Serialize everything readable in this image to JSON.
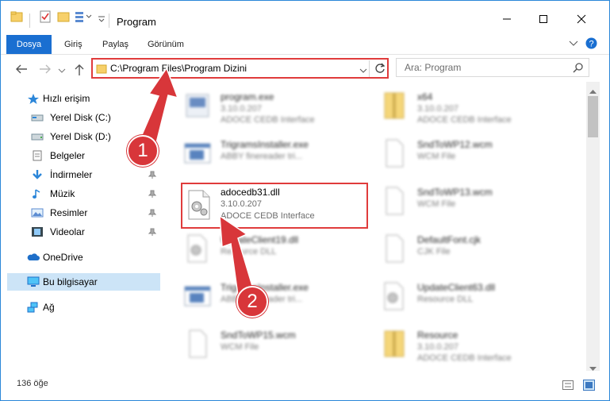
{
  "window": {
    "title": "Program"
  },
  "ribbon": {
    "tabs": [
      "Dosya",
      "Giriş",
      "Paylaş",
      "Görünüm"
    ]
  },
  "address": {
    "path": "C:\\Program Files\\Program Dizini"
  },
  "search": {
    "placeholder": "Ara: Program"
  },
  "nav": {
    "items": [
      {
        "label": "Hızlı erişim",
        "icon": "star-icon"
      },
      {
        "label": "Yerel Disk (C:)",
        "icon": "drive-icon"
      },
      {
        "label": "Yerel Disk (D:)",
        "icon": "drive-icon"
      },
      {
        "label": "Belgeler",
        "icon": "document-icon"
      },
      {
        "label": "İndirmeler",
        "icon": "download-icon"
      },
      {
        "label": "Müzik",
        "icon": "music-icon"
      },
      {
        "label": "Resimler",
        "icon": "pictures-icon"
      },
      {
        "label": "Videolar",
        "icon": "video-icon"
      },
      {
        "label": "OneDrive",
        "icon": "cloud-icon"
      },
      {
        "label": "Bu bilgisayar",
        "icon": "computer-icon"
      },
      {
        "label": "Ağ",
        "icon": "network-icon"
      }
    ]
  },
  "files": [
    {
      "name": "program.exe",
      "line2": "3.10.0.207",
      "line3": "ADOCE CEDB Interface",
      "icon": "exe-icon"
    },
    {
      "name": "x64",
      "line2": "3.10.0.207",
      "line3": "ADOCE CEDB Interface",
      "icon": "archive-icon"
    },
    {
      "name": "TrigramsInstaller.exe",
      "line2": "ABBY finereader tri...",
      "line3": "",
      "icon": "app-window-icon"
    },
    {
      "name": "SndToWP12.wcm",
      "line2": "WCM File",
      "line3": "",
      "icon": "file-icon"
    },
    {
      "name": "adocedb31.dll",
      "line2": "3.10.0.207",
      "line3": "ADOCE CEDB Interface",
      "icon": "dll-gear-icon"
    },
    {
      "name": "SndToWP13.wcm",
      "line2": "WCM File",
      "line3": "",
      "icon": "file-icon"
    },
    {
      "name": "UpdateClient19.dll",
      "line2": "Resource DLL",
      "line3": "",
      "icon": "dll-gear-icon"
    },
    {
      "name": "DefaultFont.cjk",
      "line2": "CJK File",
      "line3": "",
      "icon": "file-icon"
    },
    {
      "name": "TrigramsInstaller.exe",
      "line2": "ABBY finereader tri...",
      "line3": "",
      "icon": "app-window-icon"
    },
    {
      "name": "UpdateClient63.dll",
      "line2": "Resource DLL",
      "line3": "",
      "icon": "dll-gear-icon"
    },
    {
      "name": "SndToWP15.wcm",
      "line2": "WCM File",
      "line3": "",
      "icon": "file-icon"
    },
    {
      "name": "Resource",
      "line2": "3.10.0.207",
      "line3": "ADOCE CEDB Interface",
      "icon": "archive-icon"
    }
  ],
  "status": {
    "count": "136 öğe"
  },
  "callouts": [
    "1",
    "2"
  ],
  "colors": {
    "accent": "#1a6fd1",
    "highlight": "#e03c3c",
    "callout": "#d8363a"
  }
}
